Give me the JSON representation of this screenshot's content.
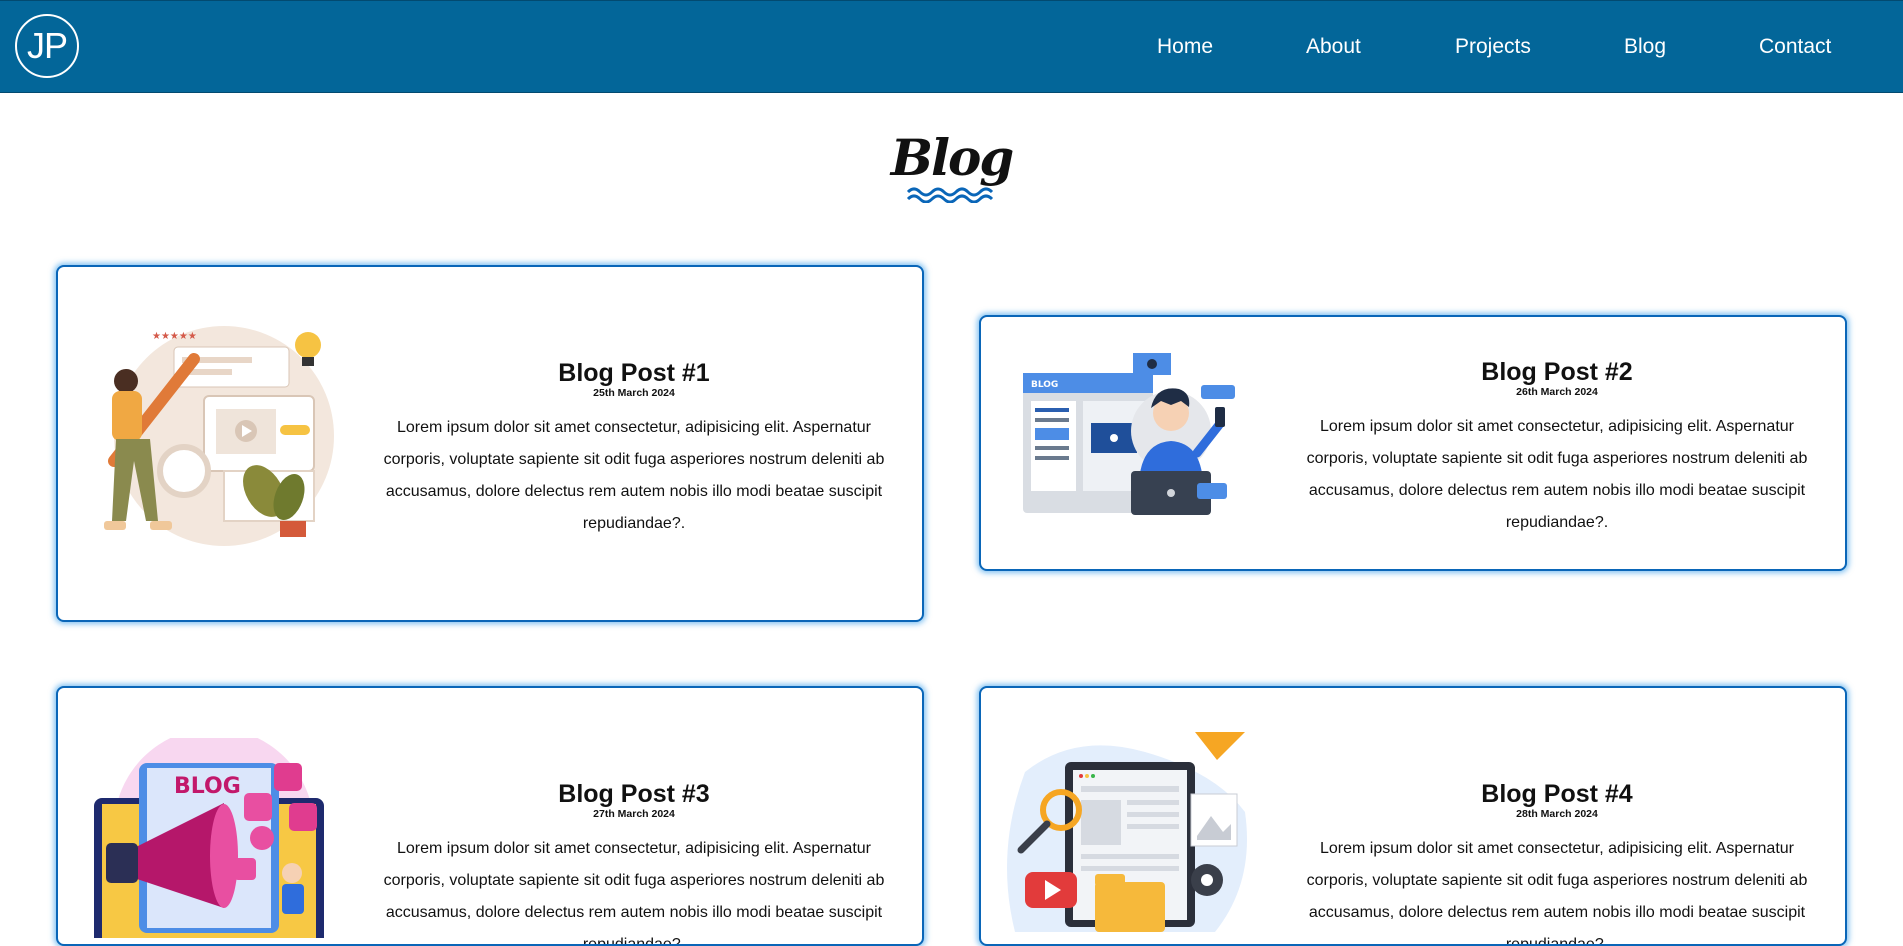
{
  "header": {
    "logo_text": "JP",
    "nav": [
      {
        "label": "Home"
      },
      {
        "label": "About"
      },
      {
        "label": "Projects"
      },
      {
        "label": "Blog"
      },
      {
        "label": "Contact"
      }
    ]
  },
  "page": {
    "title": "Blog"
  },
  "posts": [
    {
      "title": "Blog Post #1",
      "date": "25th March 2024",
      "body": "Lorem ipsum dolor sit amet consectetur, adipisicing elit. Aspernatur corporis, voluptate sapiente sit odit fuga asperiores nostrum deleniti ab accusamus, dolore delectus rem autem nobis illo modi beatae suscipit repudiandae?.",
      "image_icon": "writer-illustration"
    },
    {
      "title": "Blog Post #2",
      "date": "26th March 2024",
      "body": "Lorem ipsum dolor sit amet consectetur, adipisicing elit. Aspernatur corporis, voluptate sapiente sit odit fuga asperiores nostrum deleniti ab accusamus, dolore delectus rem autem nobis illo modi beatae suscipit repudiandae?.",
      "image_icon": "blogger-laptop-illustration",
      "image_badge": "BLOG"
    },
    {
      "title": "Blog Post #3",
      "date": "27th March 2024",
      "body": "Lorem ipsum dolor sit amet consectetur, adipisicing elit. Aspernatur corporis, voluptate sapiente sit odit fuga asperiores nostrum deleniti ab accusamus, dolore delectus rem autem nobis illo modi beatae suscipit repudiandae?.",
      "image_icon": "megaphone-blog-illustration",
      "image_badge": "BLOG"
    },
    {
      "title": "Blog Post #4",
      "date": "28th March 2024",
      "body": "Lorem ipsum dolor sit amet consectetur, adipisicing elit. Aspernatur corporis, voluptate sapiente sit odit fuga asperiores nostrum deleniti ab accusamus, dolore delectus rem autem nobis illo modi beatae suscipit repudiandae?.",
      "image_icon": "web-content-illustration"
    }
  ],
  "colors": {
    "navbar": "#036699",
    "card_border": "#0a66b8",
    "card_glow": "#1e90e6",
    "wave": "#0a66b8"
  }
}
